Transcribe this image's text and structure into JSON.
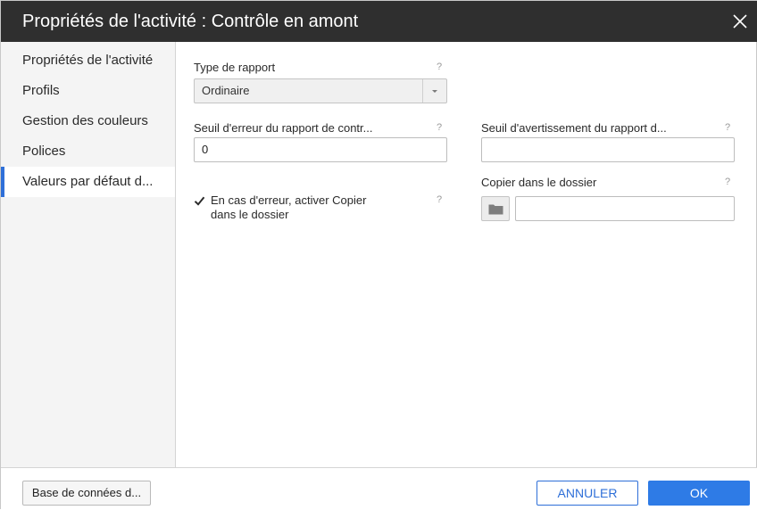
{
  "window": {
    "title": "Propriétés de l'activité : Contrôle en amont"
  },
  "sidebar": {
    "items": [
      {
        "label": "Propriétés de l'activité"
      },
      {
        "label": "Profils"
      },
      {
        "label": "Gestion des couleurs"
      },
      {
        "label": "Polices"
      },
      {
        "label": "Valeurs par défaut d..."
      }
    ],
    "active_index": 4
  },
  "form": {
    "help_glyph": "?",
    "report_type": {
      "label": "Type de rapport",
      "value": "Ordinaire"
    },
    "error_threshold": {
      "label": "Seuil d'erreur du rapport de contr...",
      "value": "0"
    },
    "warning_threshold": {
      "label": "Seuil d'avertissement du rapport d...",
      "value": ""
    },
    "copy_on_error": {
      "label_line1": "En cas d'erreur, activer Copier",
      "label_line2": "dans le dossier",
      "checked": true
    },
    "copy_folder": {
      "label": "Copier dans le dossier",
      "value": ""
    }
  },
  "footer": {
    "database_label": "Base de connées d...",
    "cancel_label": "ANNULER",
    "ok_label": "OK"
  },
  "colors": {
    "titlebar": "#2f2f2f",
    "accent": "#2e6fd8",
    "primary": "#2e7be6"
  }
}
